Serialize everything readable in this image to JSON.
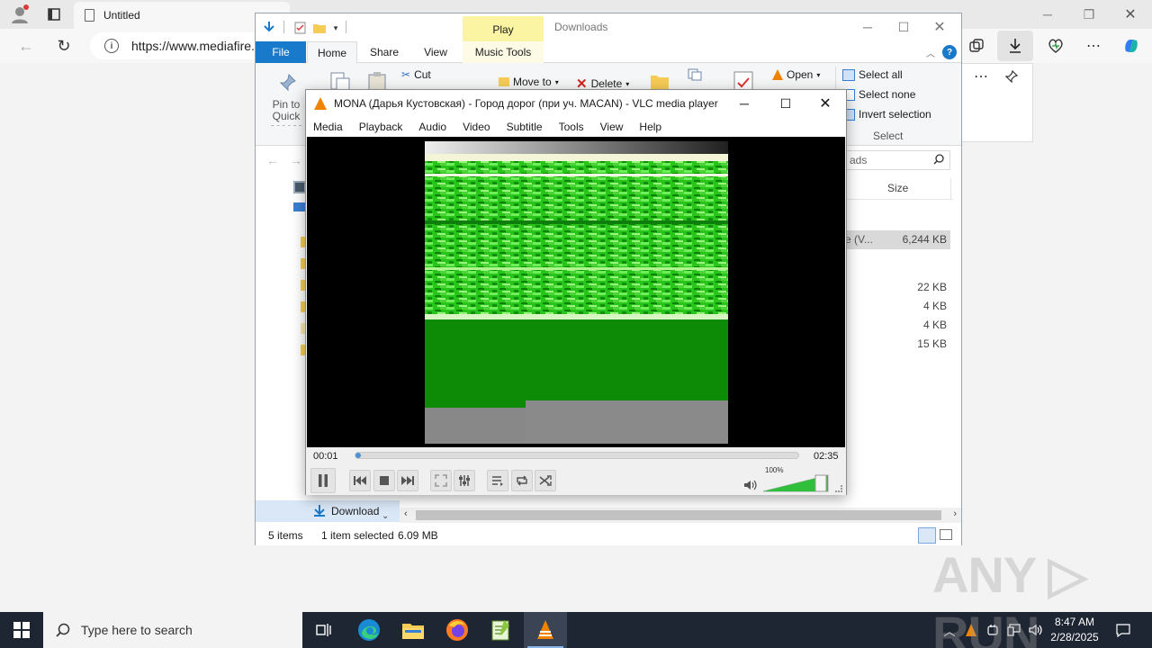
{
  "browser": {
    "tab_title": "Untitled",
    "url": "https://www.mediafire.com"
  },
  "explorer": {
    "title": "Downloads",
    "contextual_tab": "Play",
    "tabs": [
      "File",
      "Home",
      "Share",
      "View",
      "Music Tools"
    ],
    "ribbon": {
      "pin": "Pin to Quick access",
      "cut": "Cut",
      "move_to": "Move to",
      "delete": "Delete",
      "open": "Open",
      "select_all": "Select all",
      "select_none": "Select none",
      "invert_selection": "Invert selection",
      "select_group": "Select"
    },
    "search_placeholder": "Search Downloads",
    "search_visible": "ads",
    "column_size": "Size",
    "files": [
      {
        "name_fragment": "e (V...",
        "size": "6,244 KB",
        "selected": true
      },
      {
        "size": "22 KB"
      },
      {
        "size": "4 KB"
      },
      {
        "size": "4 KB"
      },
      {
        "size": "15 KB"
      }
    ],
    "nav_item": "Download",
    "status": {
      "items": "5 items",
      "selected": "1 item selected",
      "size": "6.09 MB"
    }
  },
  "vlc": {
    "title": "MONA (Дарья Кустовская) - Город дорог (при уч. MACAN) - VLC media player",
    "menu": [
      "Media",
      "Playback",
      "Audio",
      "Video",
      "Subtitle",
      "Tools",
      "View",
      "Help"
    ],
    "elapsed": "00:01",
    "total": "02:35",
    "progress_fraction": 0.01,
    "volume_label": "100%",
    "volume_fraction": 1.0,
    "state": "playing"
  },
  "taskbar": {
    "search_placeholder": "Type here to search",
    "time": "8:47 AM",
    "date": "2/28/2025",
    "apps": [
      "task-view",
      "edge",
      "file-explorer",
      "firefox",
      "notepad-plus",
      "vlc"
    ]
  },
  "watermark": "ANY RUN",
  "colors": {
    "accent": "#1979ca",
    "vlc_orange": "#f08400",
    "volume_green": "#2fbf3a",
    "taskbar": "#1f2633"
  }
}
